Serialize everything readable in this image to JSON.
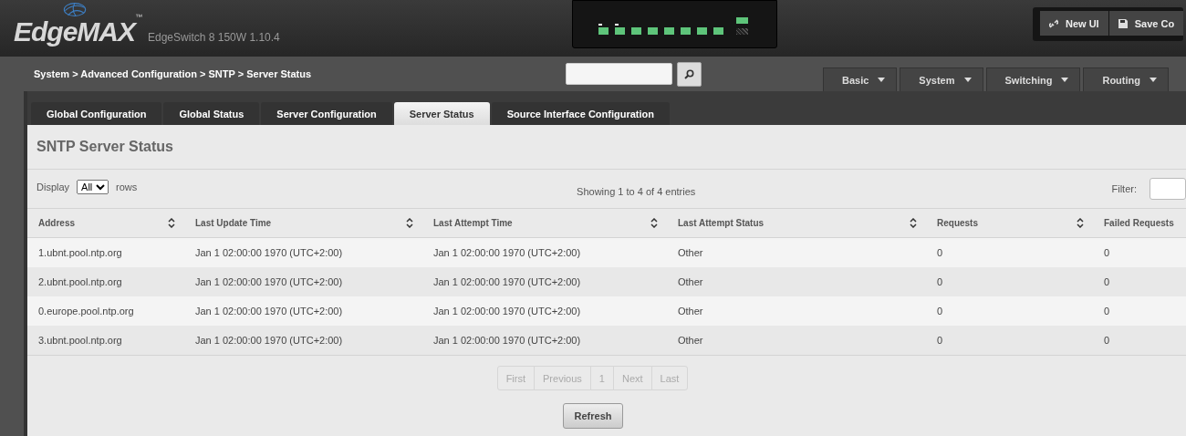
{
  "header": {
    "logo": "EdgeMAX",
    "trademark": "™",
    "device": "EdgeSwitch 8 150W 1.10.4"
  },
  "ports": [
    {
      "on": true,
      "poe": true
    },
    {
      "on": true,
      "poe": true
    },
    {
      "on": true,
      "poe": false
    },
    {
      "on": true,
      "poe": false
    },
    {
      "on": true,
      "poe": false
    },
    {
      "on": true,
      "poe": false
    },
    {
      "on": true,
      "poe": false
    },
    {
      "on": true,
      "poe": false
    }
  ],
  "sfp_ports": [
    {
      "on": true
    },
    {
      "on": false
    }
  ],
  "top_buttons": [
    "New UI",
    "Save Co"
  ],
  "breadcrumb": "System > Advanced Configuration > SNTP > Server Status",
  "menus": [
    "Basic",
    "System",
    "Switching",
    "Routing"
  ],
  "tabs": [
    {
      "label": "Global Configuration",
      "selected": false
    },
    {
      "label": "Global Status",
      "selected": false
    },
    {
      "label": "Server Configuration",
      "selected": false
    },
    {
      "label": "Server Status",
      "selected": true
    },
    {
      "label": "Source Interface Configuration",
      "selected": false
    }
  ],
  "panel_title": "SNTP Server Status",
  "display": {
    "label": "Display",
    "value": "All",
    "suffix": "rows"
  },
  "info": "Showing 1 to 4 of 4 entries",
  "filter": {
    "label": "Filter:"
  },
  "table": {
    "columns": [
      {
        "label": "Address",
        "sortable": true
      },
      {
        "label": "Last Update Time",
        "sortable": true
      },
      {
        "label": "Last Attempt Time",
        "sortable": true
      },
      {
        "label": "Last Attempt Status",
        "sortable": true
      },
      {
        "label": "Requests",
        "sortable": true
      },
      {
        "label": "Failed Requests"
      }
    ],
    "rows": [
      [
        "1.ubnt.pool.ntp.org",
        "Jan 1 02:00:00 1970 (UTC+2:00)",
        "Jan 1 02:00:00 1970 (UTC+2:00)",
        "Other",
        "0",
        "0"
      ],
      [
        "2.ubnt.pool.ntp.org",
        "Jan 1 02:00:00 1970 (UTC+2:00)",
        "Jan 1 02:00:00 1970 (UTC+2:00)",
        "Other",
        "0",
        "0"
      ],
      [
        "0.europe.pool.ntp.org",
        "Jan 1 02:00:00 1970 (UTC+2:00)",
        "Jan 1 02:00:00 1970 (UTC+2:00)",
        "Other",
        "0",
        "0"
      ],
      [
        "3.ubnt.pool.ntp.org",
        "Jan 1 02:00:00 1970 (UTC+2:00)",
        "Jan 1 02:00:00 1970 (UTC+2:00)",
        "Other",
        "0",
        "0"
      ]
    ]
  },
  "pager": [
    {
      "label": "First",
      "disabled": true
    },
    {
      "label": "Previous",
      "disabled": true
    },
    {
      "label": "1",
      "disabled": true
    },
    {
      "label": "Next",
      "disabled": true
    },
    {
      "label": "Last",
      "disabled": true
    }
  ],
  "refresh": "Refresh"
}
